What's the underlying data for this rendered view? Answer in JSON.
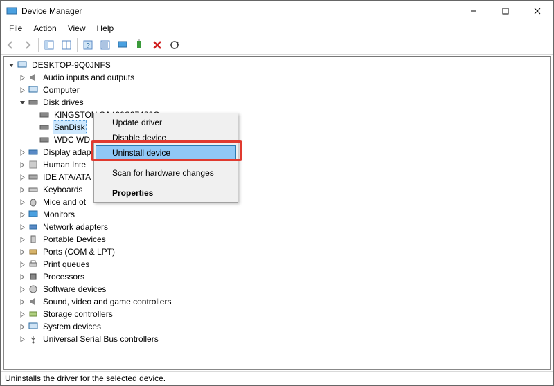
{
  "window": {
    "title": "Device Manager"
  },
  "menu": {
    "file": "File",
    "action": "Action",
    "view": "View",
    "help": "Help"
  },
  "toolbar_icons": {
    "back": "back-arrow-icon",
    "forward": "forward-arrow-icon",
    "show_hide": "panel-icon",
    "panel2": "panel-check-icon",
    "help": "help-icon",
    "props": "properties-icon",
    "monitor": "monitor-icon",
    "enable": "enable-device-icon",
    "delete": "delete-icon",
    "scan": "scan-hardware-icon"
  },
  "tree": {
    "root": "DESKTOP-9Q0JNFS",
    "audio": "Audio inputs and outputs",
    "computer": "Computer",
    "disk_drives": "Disk drives",
    "disk_kingston": "KINGSTON SA400S37480G",
    "disk_sandisk": "SanDisk",
    "disk_wdc": "WDC WD",
    "display": "Display adap",
    "hid": "Human Inte",
    "ide": "IDE ATA/ATA",
    "keyboards": "Keyboards",
    "mice": "Mice and ot",
    "monitors": "Monitors",
    "network": "Network adapters",
    "portable": "Portable Devices",
    "ports": "Ports (COM & LPT)",
    "printq": "Print queues",
    "processors": "Processors",
    "software": "Software devices",
    "sound": "Sound, video and game controllers",
    "storage": "Storage controllers",
    "system": "System devices",
    "usb": "Universal Serial Bus controllers"
  },
  "context_menu": {
    "update": "Update driver",
    "disable": "Disable device",
    "uninstall": "Uninstall device",
    "scan": "Scan for hardware changes",
    "properties": "Properties"
  },
  "status": "Uninstalls the driver for the selected device."
}
